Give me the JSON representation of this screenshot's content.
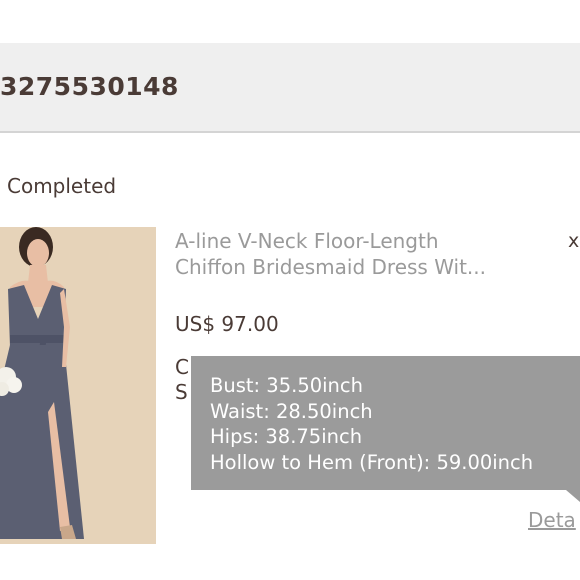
{
  "order": {
    "number": "3275530148",
    "status": "Completed"
  },
  "product": {
    "title_line1": "A-line V-Neck Floor-Length",
    "title_line2": "Chiffon Bridesmaid Dress Wit...",
    "price": "US$ 97.00",
    "remove_label": "x",
    "detail_line1": "C",
    "detail_line2": "S",
    "details_link": "Deta",
    "dress_color": "#5b5f72",
    "photo_bg": "#e6d3b9"
  },
  "tooltip": {
    "lines": [
      "Bust: 35.50inch",
      "Waist: 28.50inch",
      "Hips: 38.75inch",
      "Hollow to Hem (Front): 59.00inch"
    ]
  }
}
